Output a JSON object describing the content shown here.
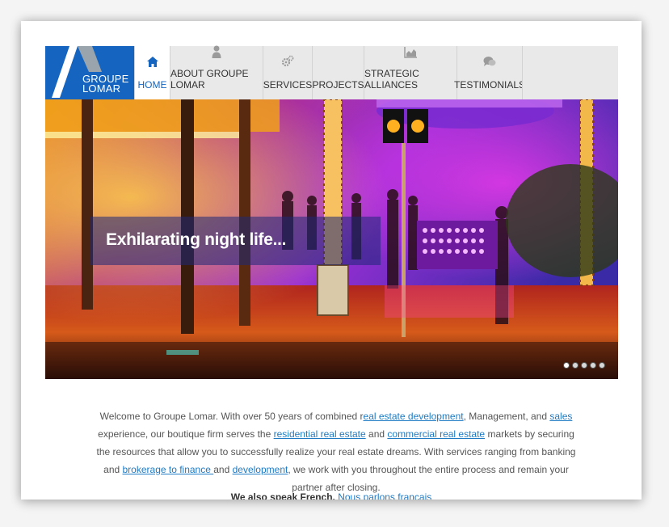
{
  "brand": {
    "line1": "GROUPE",
    "line2": "LOMAR"
  },
  "nav": {
    "items": [
      {
        "label": "HOME",
        "icon": "home-icon"
      },
      {
        "label": "ABOUT GROUPE LOMAR",
        "icon": "person-icon"
      },
      {
        "label": "SERVICES",
        "icon": "gears-icon"
      },
      {
        "label": "PROJECTS",
        "icon": ""
      },
      {
        "label": "STRATEGIC ALLIANCES",
        "icon": "bar-chart-icon"
      },
      {
        "label": "TESTIMONIALS",
        "icon": "chat-bubbles-icon"
      }
    ],
    "active": "HOME"
  },
  "hero": {
    "caption": "Exhilarating night life...",
    "slide_count": 5,
    "active_slide": 1
  },
  "intro": {
    "t1": "Welcome to Groupe Lomar. With over 50 years of combined r",
    "l1": "eal estate development",
    "t2": ", Management, and ",
    "l2": "sales",
    "t3": " experience, our boutique firm serves the ",
    "l3": "residential real estate",
    "t4": " and ",
    "l4": "commercial real estate",
    "t5": " markets by securing the resources that allow you to successfully realize your real estate dreams. With services ranging from banking and ",
    "l5": "brokerage to finance ",
    "t6": "and ",
    "l6": "development",
    "t7": ", we work with you throughout the entire process and remain your partner after closing."
  },
  "french": {
    "bold": "We also speak French.",
    "link": "Nous parlons français"
  },
  "colors": {
    "brand_blue": "#1565c0",
    "link": "#1e7bc4",
    "nav_bg": "#e9e9e9"
  }
}
